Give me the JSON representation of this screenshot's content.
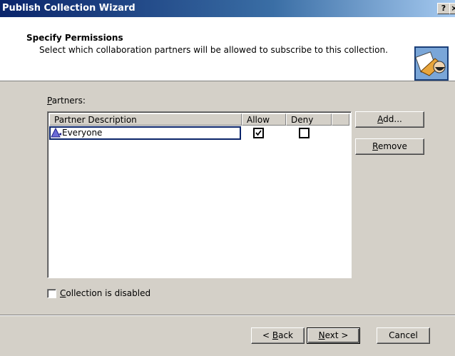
{
  "window": {
    "title": "Publish Collection Wizard",
    "help_glyph": "?",
    "close_glyph": "×"
  },
  "header": {
    "title": "Specify Permissions",
    "subtitle": "Select which collaboration partners will be allowed to subscribe to this collection."
  },
  "partners": {
    "label_accel": "P",
    "label_rest": "artners:",
    "columns": [
      "Partner Description",
      "Allow",
      "Deny"
    ],
    "rows": [
      {
        "description": "Everyone",
        "allow": true,
        "deny": false,
        "icon": "group-icon"
      }
    ]
  },
  "side_buttons": {
    "add_accel": "A",
    "add_rest": "dd...",
    "remove_accel": "R",
    "remove_rest": "emove"
  },
  "disabled_checkbox": {
    "accel": "C",
    "rest": "ollection is disabled",
    "checked": false
  },
  "footer": {
    "back_pre": "< ",
    "back_accel": "B",
    "back_rest": "ack",
    "next_accel": "N",
    "next_rest": "ext >",
    "cancel": "Cancel"
  }
}
